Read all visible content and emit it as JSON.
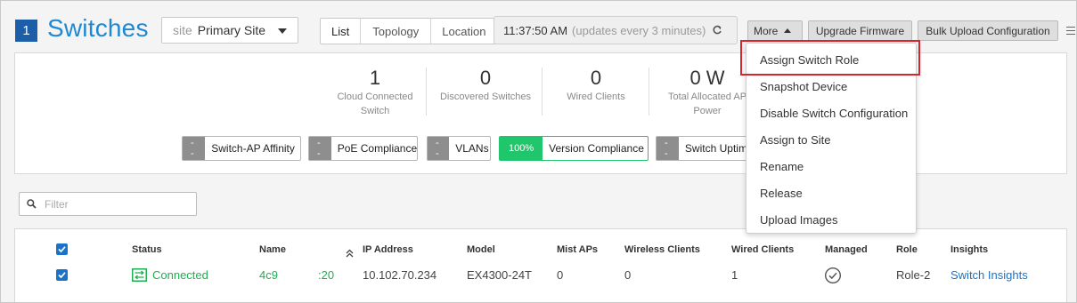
{
  "header": {
    "count": "1",
    "title": "Switches",
    "site_label": "site",
    "site_value": "Primary Site",
    "tabs": [
      "List",
      "Topology",
      "Location"
    ],
    "time": "11:37:50 AM",
    "update_note": "(updates every 3 minutes)",
    "more_label": "More",
    "upgrade_label": "Upgrade Firmware",
    "bulk_label": "Bulk Upload Configuration"
  },
  "stats": [
    {
      "value": "1",
      "label_line1": "Cloud Connected",
      "label_line2": "Switch"
    },
    {
      "value": "0",
      "label_line1": "Discovered Switches",
      "label_line2": ""
    },
    {
      "value": "0",
      "label_line1": "Wired Clients",
      "label_line2": ""
    },
    {
      "value": "0 W",
      "label_line1": "Total Allocated AP",
      "label_line2": "Power"
    }
  ],
  "sle_chips": [
    {
      "pct": "--",
      "name": "Switch-AP Affinity"
    },
    {
      "pct": "--",
      "name": "PoE Compliance"
    },
    {
      "pct": "--",
      "name": "VLANs"
    },
    {
      "pct": "100%",
      "name": "Version Compliance"
    },
    {
      "pct": "--",
      "name": "Switch Uptim"
    }
  ],
  "filter": {
    "placeholder": "Filter"
  },
  "table": {
    "columns": [
      "Status",
      "Name",
      "IP Address",
      "Model",
      "Mist APs",
      "Wireless Clients",
      "Wired Clients",
      "Managed",
      "Role",
      "Insights"
    ],
    "rows": [
      {
        "status": "Connected",
        "name_prefix": "4c9",
        "name_suffix": ":20",
        "ip": "10.102.70.234",
        "model": "EX4300-24T",
        "mist_aps": "0",
        "wireless_clients": "0",
        "wired_clients": "1",
        "role": "Role-2",
        "insights": "Switch Insights"
      }
    ]
  },
  "more_menu": {
    "items": [
      "Assign Switch Role",
      "Snapshot Device",
      "Disable Switch Configuration",
      "Assign to Site",
      "Rename",
      "Release",
      "Upload Images"
    ]
  },
  "colors": {
    "title_blue": "#1e88d4",
    "badge_blue": "#1c5fa8",
    "connected_green": "#1fae52",
    "compliance_green": "#1fc66b",
    "highlight_red": "#d9232d",
    "link_blue": "#1a73c9"
  }
}
